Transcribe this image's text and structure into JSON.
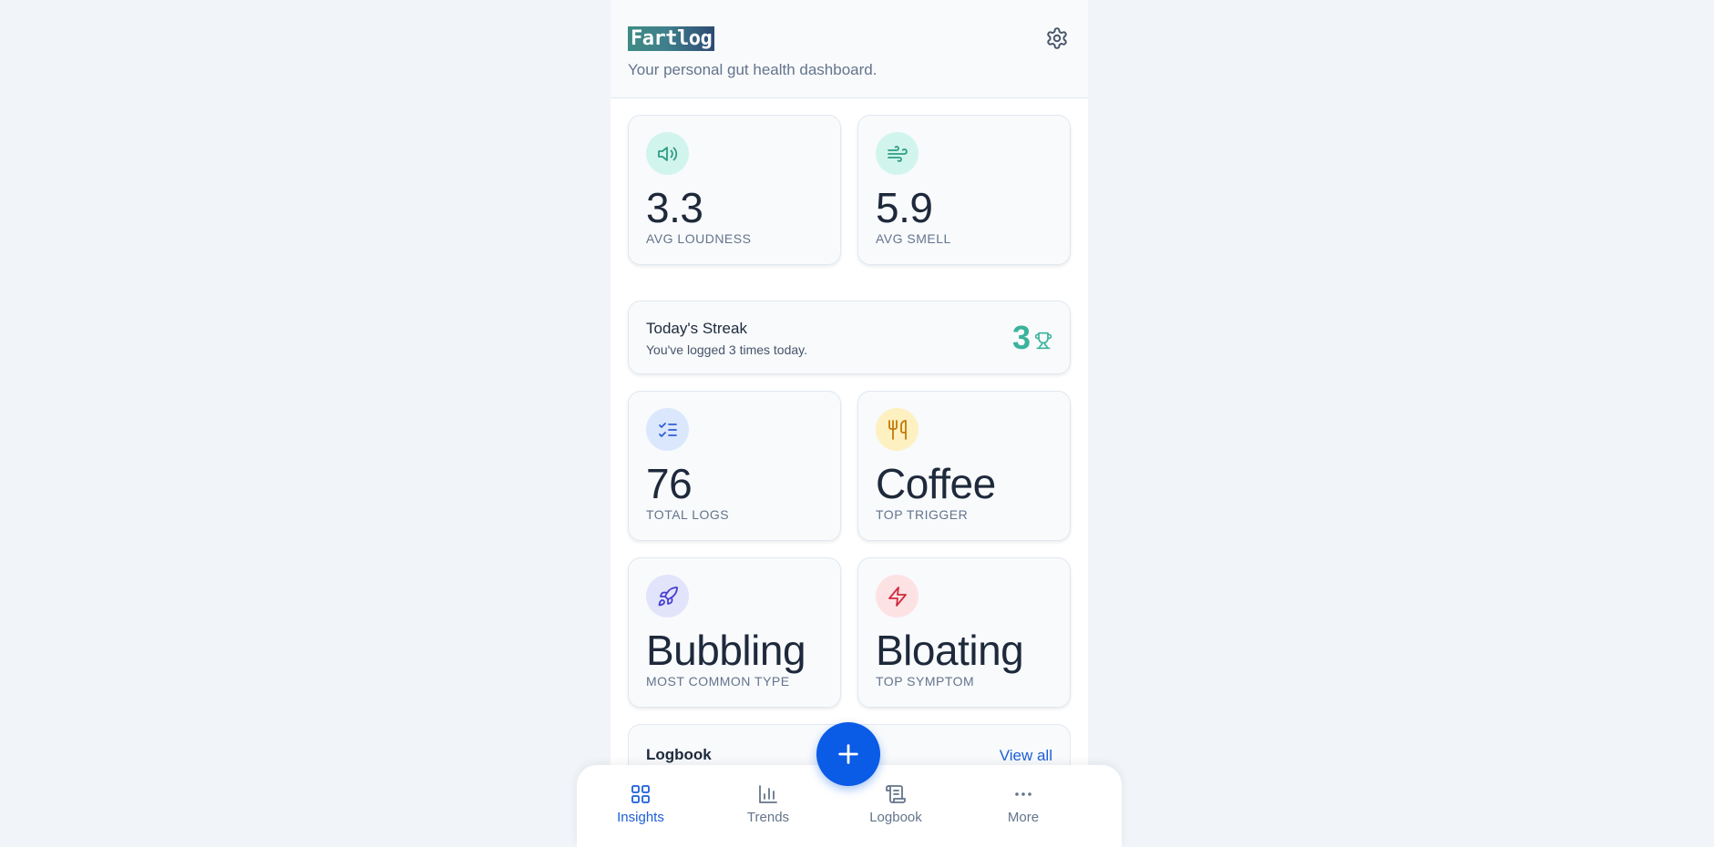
{
  "header": {
    "logo_text": "Fartlog",
    "tagline": "Your personal gut health dashboard.",
    "settings_icon": "gear-icon"
  },
  "stats_top": [
    {
      "id": "loudness",
      "icon": "speaker-icon",
      "icon_bg": "#d1f5ec",
      "icon_color": "#2f9c85",
      "value": "3.3",
      "label": "AVG LOUDNESS"
    },
    {
      "id": "smell",
      "icon": "wind-icon",
      "icon_bg": "#d1f5ec",
      "icon_color": "#2f9c85",
      "value": "5.9",
      "label": "AVG SMELL"
    }
  ],
  "streak": {
    "title": "Today's Streak",
    "subtitle": "You've logged 3 times today.",
    "count": "3",
    "icon": "trophy-icon",
    "accent": "#3bb39b"
  },
  "stats_middle": [
    {
      "id": "total-logs",
      "icon": "checklist-icon",
      "icon_bg": "#dbe7fd",
      "icon_color": "#2f5fd8",
      "value": "76",
      "label": "TOTAL LOGS"
    },
    {
      "id": "top-trigger",
      "icon": "utensils-icon",
      "icon_bg": "#fdf1c2",
      "icon_color": "#c27a06",
      "value": "Coffee",
      "label": "TOP TRIGGER"
    }
  ],
  "stats_bottom": [
    {
      "id": "common-type",
      "icon": "rocket-icon",
      "icon_bg": "#e2e4fb",
      "icon_color": "#4a3fd0",
      "value": "Bubbling",
      "label": "MOST COMMON TYPE"
    },
    {
      "id": "top-symptom",
      "icon": "zap-icon",
      "icon_bg": "#fde2e4",
      "icon_color": "#d02a3e",
      "value": "Bloating",
      "label": "TOP SYMPTOM"
    }
  ],
  "logbook": {
    "title": "Logbook",
    "view_all": "View all"
  },
  "nav": {
    "items": [
      {
        "label": "Insights",
        "icon": "grid-icon",
        "active": true
      },
      {
        "label": "Trends",
        "icon": "bar-chart-icon",
        "active": false
      },
      {
        "label": "Logbook",
        "icon": "scroll-icon",
        "active": false
      },
      {
        "label": "More",
        "icon": "more-dots-icon",
        "active": false
      }
    ],
    "fab_icon": "plus-icon",
    "active_color": "#1d5fd8",
    "inactive_color": "#64748b"
  }
}
